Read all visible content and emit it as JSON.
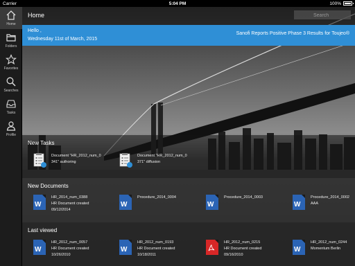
{
  "statusbar": {
    "carrier": "Carrier",
    "time": "5:04 PM",
    "battery": "100%"
  },
  "header": {
    "title": "Home",
    "search_placeholder": "Search"
  },
  "banner": {
    "greeting": "Hello ,",
    "date": "Wednesday 11st of March, 2015",
    "news": "Sanofi Reports Positive Phase 3 Results for Toujeo®"
  },
  "sidebar": {
    "items": [
      {
        "label": "Home",
        "icon": "home-icon"
      },
      {
        "label": "Folders",
        "icon": "folder-icon"
      },
      {
        "label": "Favorites",
        "icon": "star-icon"
      },
      {
        "label": "Searches",
        "icon": "search-icon"
      },
      {
        "label": "Tasks",
        "icon": "inbox-icon"
      },
      {
        "label": "Profile",
        "icon": "person-icon"
      }
    ]
  },
  "tasks": {
    "title": "New Tasks",
    "items": [
      {
        "line1": "Document \"HR_2012_num_0",
        "line2": "341\" authoring"
      },
      {
        "line1": "Document \"HR_2012_num_0",
        "line2": "371\" diffusion"
      }
    ]
  },
  "documents": {
    "title": "New Documents",
    "items": [
      {
        "name": "HR_2014_num_0388",
        "line2": "HR Document created",
        "line3": "09/12/2014",
        "type": "word"
      },
      {
        "name": "Procedure_2014_0004",
        "line2": "",
        "line3": "",
        "type": "word"
      },
      {
        "name": "Procedure_2014_0003",
        "line2": "",
        "line3": "",
        "type": "word"
      },
      {
        "name": "Procedure_2014_0002",
        "line2": "AAA",
        "line3": "",
        "type": "word"
      }
    ]
  },
  "last_viewed": {
    "title": "Last viewed",
    "items": [
      {
        "name": "HR_2012_num_0057",
        "line2": "HR Document created",
        "line3": "10/26/2010",
        "type": "word"
      },
      {
        "name": "HR_2012_num_0193",
        "line2": "HR Document created",
        "line3": "10/18/2011",
        "type": "word"
      },
      {
        "name": "HR_2012_num_0215",
        "line2": "HR Document created",
        "line3": "09/16/2010",
        "type": "pdf"
      },
      {
        "name": "HR_2012_num_0244",
        "line2": "Momentum Berlin",
        "line3": "",
        "type": "word"
      }
    ]
  },
  "colors": {
    "accent": "#2f8fd6",
    "word": "#2b64b5",
    "pdf": "#d72727"
  }
}
